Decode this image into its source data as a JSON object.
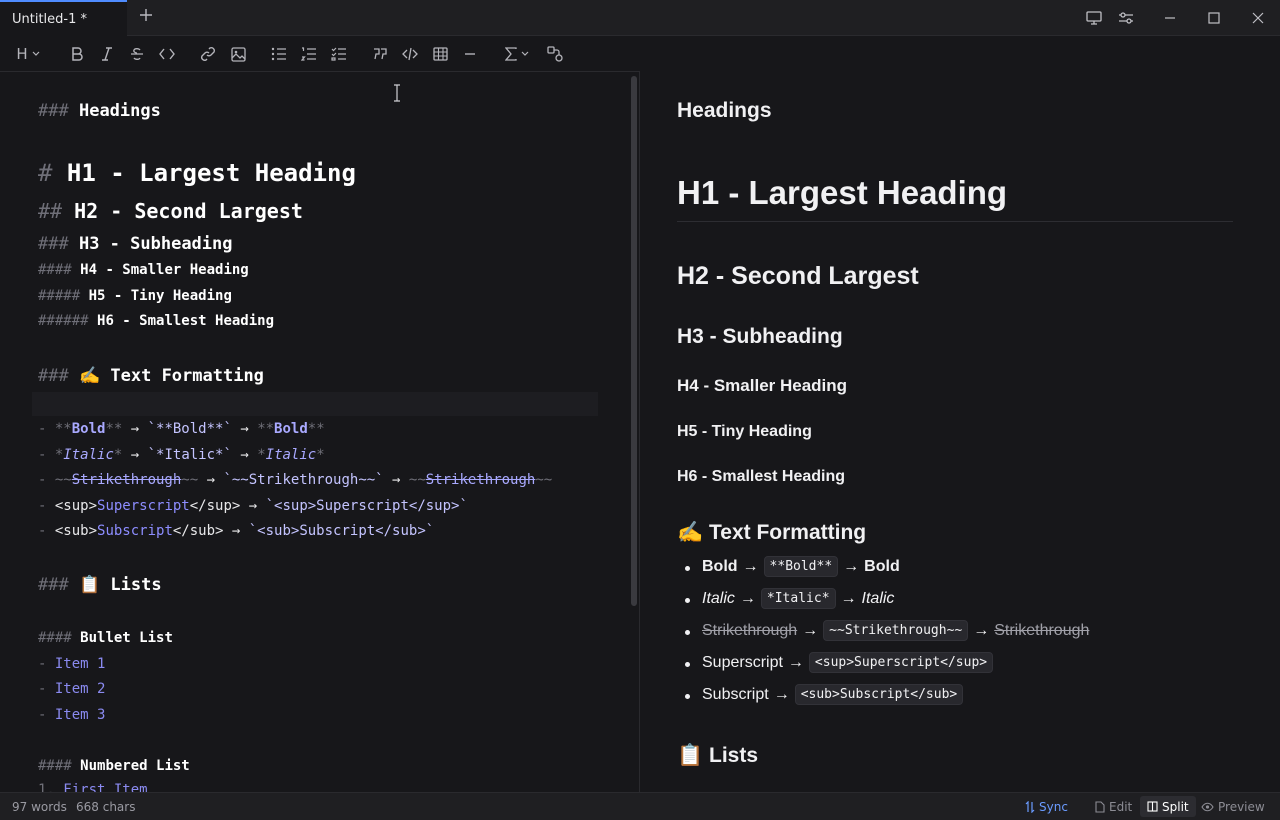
{
  "tab": {
    "title": "Untitled-1 *"
  },
  "toolbar": {
    "heading_label": "H"
  },
  "editor": {
    "lines": {
      "l1": {
        "m": "###",
        "t": "Headings"
      },
      "l2": {
        "m": "#",
        "t": "H1 - Largest Heading"
      },
      "l3": {
        "m": "##",
        "t": "H2 - Second Largest"
      },
      "l4": {
        "m": "###",
        "t": "H3 - Subheading"
      },
      "l5": {
        "m": "####",
        "t": "H4 - Smaller Heading"
      },
      "l6": {
        "m": "#####",
        "t": "H5 - Tiny Heading"
      },
      "l7": {
        "m": "######",
        "t": "H6 - Smallest Heading"
      },
      "l8": {
        "m": "###",
        "emoji": "✍️",
        "t": "Text Formatting"
      },
      "l9": {
        "p1": "**",
        "a": "Bold",
        "p2": "**",
        "arrow": " → ",
        "code": "`**Bold**`",
        "arrow2": " → ",
        "p3": "**",
        "b": "Bold",
        "p4": "**"
      },
      "l10": {
        "p1": "*",
        "a": "Italic",
        "p2": "*",
        "arrow": " → ",
        "code": "`*Italic*`",
        "arrow2": " → ",
        "p3": "*",
        "b": "Italic",
        "p4": "*"
      },
      "l11": {
        "p1": "~~",
        "a": "Strikethrough",
        "p2": "~~",
        "arrow": " → ",
        "code": "`~~Strikethrough~~`",
        "arrow2": " → ",
        "p3": "~~",
        "b": "Strikethrough",
        "p4": "~~"
      },
      "l12": {
        "t1": "<sup>",
        "a": "Superscript",
        "t2": "</sup>",
        "arrow": " → ",
        "code": "`<sup>Superscript</sup>`"
      },
      "l13": {
        "t1": "<sub>",
        "a": "Subscript",
        "t2": "</sub>",
        "arrow": " → ",
        "code": "`<sub>Subscript</sub>`"
      },
      "l14": {
        "m": "###",
        "emoji": "📋",
        "t": "Lists"
      },
      "l15": {
        "m": "####",
        "t": "Bullet List"
      },
      "l16": {
        "dash": "-",
        "t": "Item 1"
      },
      "l17": {
        "dash": "-",
        "t": "Item 2"
      },
      "l18": {
        "dash": "-",
        "t": "Item 3"
      },
      "l19": {
        "m": "####",
        "t": "Numbered List"
      },
      "l20": {
        "num": "1.",
        "t": "First Item"
      }
    }
  },
  "preview": {
    "headings_title": "Headings",
    "h1": "H1 - Largest Heading",
    "h2": "H2 - Second Largest",
    "h3": "H3 - Subheading",
    "h4": "H4 - Smaller Heading",
    "h5": "H5 - Tiny Heading",
    "h6": "H6 - Smallest Heading",
    "text_formatting": {
      "emoji": "✍️",
      "title": "Text Formatting"
    },
    "items": {
      "bold": {
        "a": "Bold",
        "arrow": "→",
        "code": "**Bold**",
        "arrow2": "→",
        "b": "Bold"
      },
      "italic": {
        "a": "Italic",
        "arrow": "→",
        "code": "*Italic*",
        "arrow2": "→",
        "b": "Italic"
      },
      "strike": {
        "a": "Strikethrough",
        "arrow": "→",
        "code": "~~Strikethrough~~",
        "arrow2": "→",
        "b": "Strikethrough"
      },
      "sup": {
        "a": "Superscript",
        "arrow": "→",
        "code": "<sup>Superscript</sup>"
      },
      "sub": {
        "a": "Subscript",
        "arrow": "→",
        "code": "<sub>Subscript</sub>"
      }
    },
    "lists": {
      "emoji": "📋",
      "title": "Lists"
    }
  },
  "status": {
    "words": "97 words",
    "chars": "668 chars",
    "sync": "Sync",
    "edit": "Edit",
    "split": "Split",
    "preview": "Preview"
  },
  "colors": {
    "accent": "#4f8cff",
    "link_syntax": "#a9a9ff",
    "background": "#17171a"
  }
}
